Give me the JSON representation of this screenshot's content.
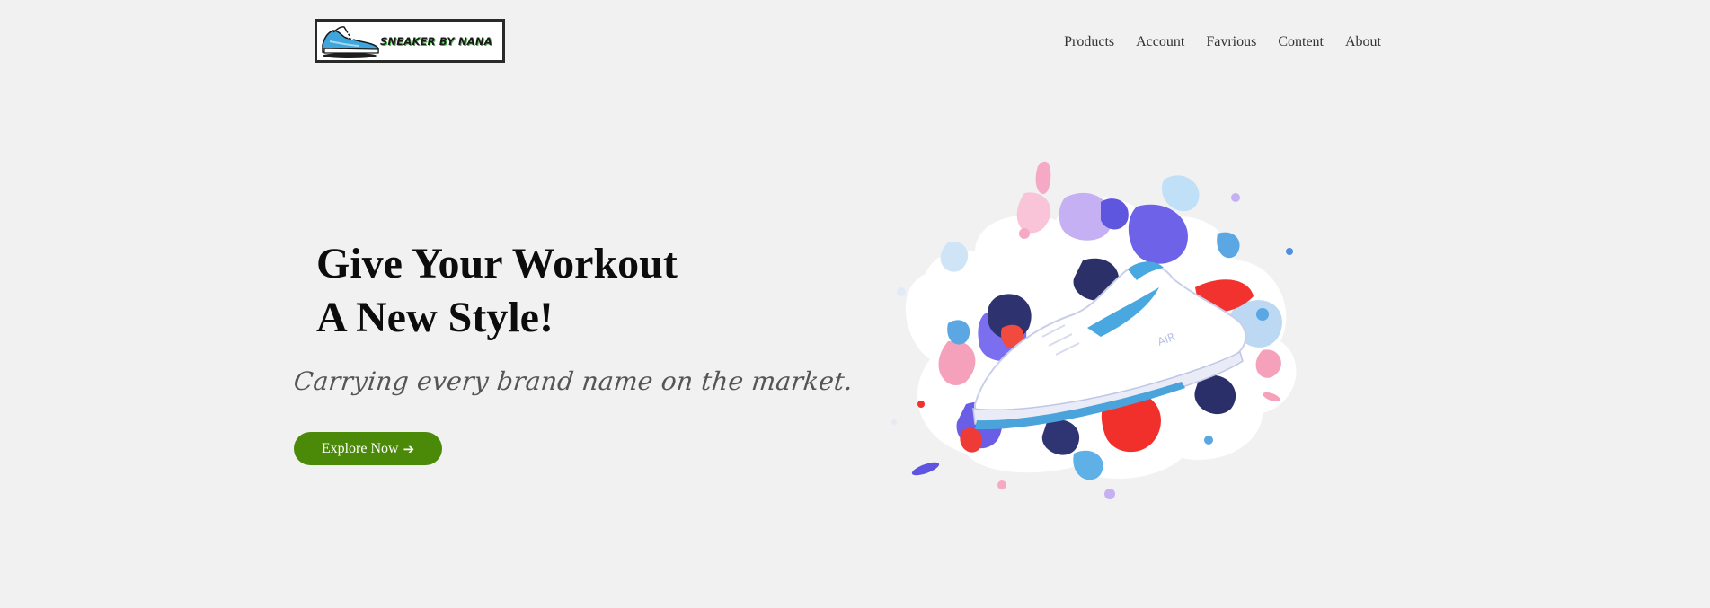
{
  "header": {
    "logo_text": "SNEAKER BY NANA",
    "nav": [
      {
        "label": "Products"
      },
      {
        "label": "Account"
      },
      {
        "label": "Favrious"
      },
      {
        "label": "Content"
      },
      {
        "label": "About"
      }
    ]
  },
  "hero": {
    "title_line1": "Give Your Workout",
    "title_line2": "A New Style!",
    "tagline": "Carrying every brand name on the market.",
    "cta_label": "Explore Now",
    "cta_icon": "arrow-right-icon",
    "illustration": "sneaker-paint-splash-illustration",
    "shoe_text": "AIR"
  },
  "colors": {
    "background": "#f1f1f1",
    "cta": "#4a8a08",
    "text": "#0c0c0c"
  }
}
